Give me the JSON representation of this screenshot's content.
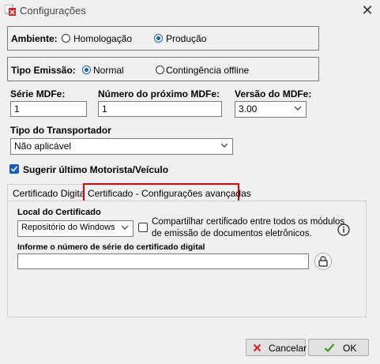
{
  "window": {
    "title": "Configurações",
    "close_icon": "close-icon",
    "app_icon": "app-logo-icon"
  },
  "ambiente": {
    "label": "Ambiente:",
    "options": [
      "Homologação",
      "Produção"
    ],
    "selected": "Produção"
  },
  "tipo_emissao": {
    "label": "Tipo Emissão:",
    "options": [
      "Normal",
      "Contingência offline"
    ],
    "selected": "Normal"
  },
  "serie": {
    "label": "Série MDFe:",
    "value": "1"
  },
  "numero": {
    "label": "Número do próximo MDFe:",
    "value": "1"
  },
  "versao": {
    "label": "Versão do MDFe:",
    "value": "3.00"
  },
  "transportador": {
    "label": "Tipo do Transportador",
    "value": "Não aplicável"
  },
  "sugerir": {
    "label": "Sugerir último Motorista/Veículo",
    "checked": true
  },
  "tabs": [
    {
      "label": "Certificado Digital",
      "active": true
    },
    {
      "label": "Certificado - Configurações avançadas",
      "active": false,
      "highlight_color": "#e00000"
    }
  ],
  "certificado": {
    "local_label": "Local do Certificado",
    "local_value": "Repositório do Windows",
    "compartilhar_label_1": "Compartilhar certificado entre todos os módulos",
    "compartilhar_label_2": "de emissão de documentos eletrônicos.",
    "compartilhar_checked": false,
    "info_icon": "info-icon",
    "serie_label": "Informe o número de série do certificado digital",
    "serie_value": "",
    "search_icon": "certificate-search-icon"
  },
  "buttons": {
    "cancel_label": "Cancelar",
    "ok_label": "OK",
    "cancel_icon": "x-icon",
    "ok_icon": "check-icon"
  },
  "colors": {
    "accent": "#1a5fb4",
    "highlight": "#e00000",
    "cancel_icon": "#cc2222",
    "ok_icon": "#3a9a1a"
  }
}
